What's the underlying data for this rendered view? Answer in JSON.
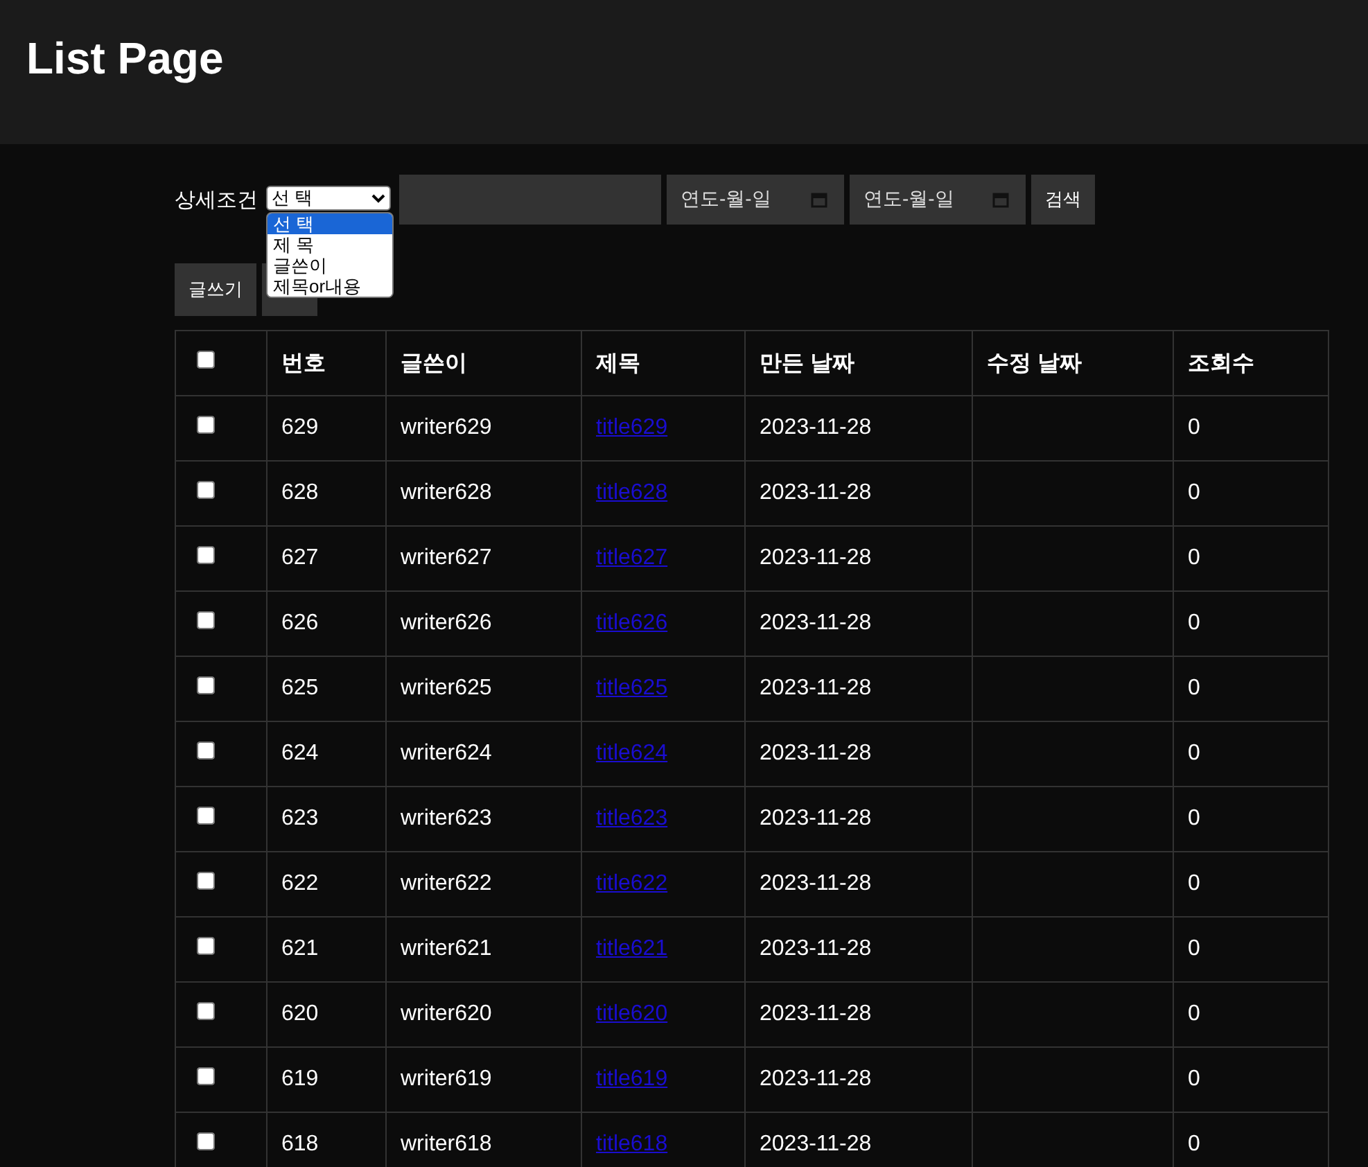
{
  "header": {
    "title": "List Page"
  },
  "search": {
    "label": "상세조건",
    "select_value": "선 택",
    "options": [
      {
        "label": "선 택",
        "selected": true
      },
      {
        "label": "제 목",
        "selected": false
      },
      {
        "label": "글쓴이",
        "selected": false
      },
      {
        "label": "제목or내용",
        "selected": false
      }
    ],
    "date_from": {
      "placeholder": "연도-월-일"
    },
    "date_to": {
      "placeholder": "연도-월-일"
    },
    "submit": "검색"
  },
  "actions": [
    "글쓰기"
  ],
  "table": {
    "select_all": false,
    "columns": [
      "번호",
      "글쓴이",
      "제목",
      "만든 날짜",
      "수정 날짜",
      "조회수"
    ],
    "rows": [
      {
        "checked": false,
        "cells": [
          "629",
          "writer629",
          "title629",
          "2023-11-28",
          null,
          "0"
        ]
      },
      {
        "checked": false,
        "cells": [
          "628",
          "writer628",
          "title628",
          "2023-11-28",
          null,
          "0"
        ]
      },
      {
        "checked": false,
        "cells": [
          "627",
          "writer627",
          "title627",
          "2023-11-28",
          null,
          "0"
        ]
      },
      {
        "checked": false,
        "cells": [
          "626",
          "writer626",
          "title626",
          "2023-11-28",
          null,
          "0"
        ]
      },
      {
        "checked": false,
        "cells": [
          "625",
          "writer625",
          "title625",
          "2023-11-28",
          null,
          "0"
        ]
      },
      {
        "checked": false,
        "cells": [
          "624",
          "writer624",
          "title624",
          "2023-11-28",
          null,
          "0"
        ]
      },
      {
        "checked": false,
        "cells": [
          "623",
          "writer623",
          "title623",
          "2023-11-28",
          null,
          "0"
        ]
      },
      {
        "checked": false,
        "cells": [
          "622",
          "writer622",
          "title622",
          "2023-11-28",
          null,
          "0"
        ]
      },
      {
        "checked": false,
        "cells": [
          "621",
          "writer621",
          "title621",
          "2023-11-28",
          null,
          "0"
        ]
      },
      {
        "checked": false,
        "cells": [
          "620",
          "writer620",
          "title620",
          "2023-11-28",
          null,
          "0"
        ]
      },
      {
        "checked": false,
        "cells": [
          "619",
          "writer619",
          "title619",
          "2023-11-28",
          null,
          "0"
        ]
      },
      {
        "checked": false,
        "cells": [
          "618",
          "writer618",
          "title618",
          "2023-11-28",
          null,
          "0"
        ]
      }
    ]
  }
}
